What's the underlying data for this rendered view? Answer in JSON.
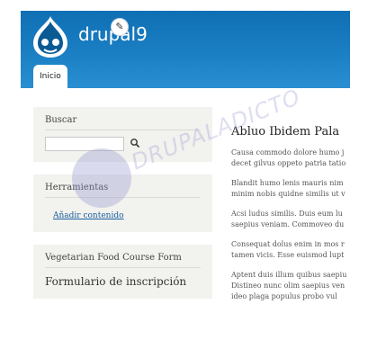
{
  "header": {
    "site_name": "drupal9",
    "edit_icon": "pencil-icon",
    "tabs": [
      {
        "label": "Inicio"
      }
    ]
  },
  "sidebar": {
    "search": {
      "title": "Buscar",
      "value": "",
      "button_icon": "search-icon"
    },
    "tools": {
      "title": "Herramientas",
      "link": "Añadir contenido"
    },
    "food": {
      "title": "Vegetarian Food Course Form",
      "form_link": "Formulario de inscripción"
    }
  },
  "main": {
    "title": "Abluo Ibidem Pala",
    "paragraphs": [
      [
        "Causa commodo dolore humo j",
        "decet gilvus oppeto patria tatio"
      ],
      [
        "Blandit humo lenis mauris nim",
        "minim nobis quidne similis ut v"
      ],
      [
        "Acsi ludus similis. Duis eum lu",
        "saepius veniam. Commoveo du"
      ],
      [
        "Consequat dolus enim in mos r",
        "tamen vicis. Esse euismod lupt"
      ],
      [
        "Aptent duis illum quibus saepiu",
        "Distineo nunc olim saepius ven",
        "ideo plaga populus probo vul"
      ]
    ]
  },
  "watermark": {
    "text": "DRUPALADICTO",
    "color": "#a0a0d7"
  },
  "colors": {
    "header_start": "#0f6fb3",
    "header_end": "#2a8fd2",
    "block_bg": "#f2f2ee",
    "link": "#1a5fa0"
  }
}
